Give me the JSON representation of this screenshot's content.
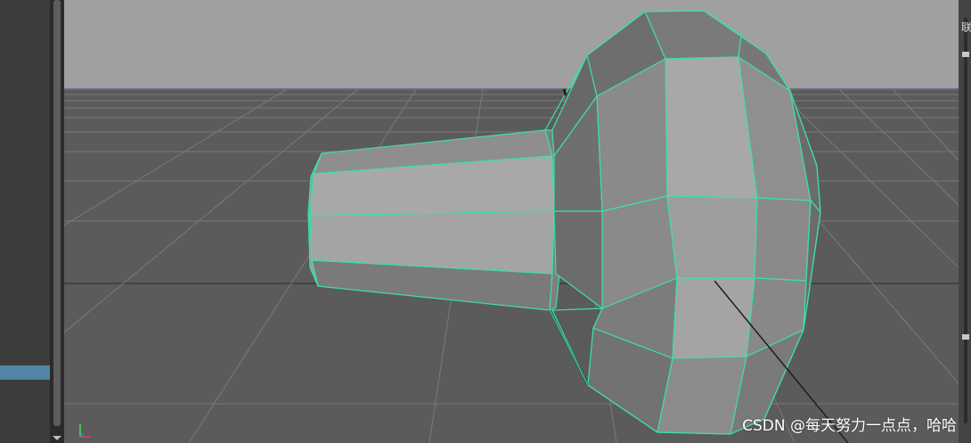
{
  "app": {
    "name": "3D modeling viewport",
    "view": "perspective",
    "object": "polygon mesh (lathe-like knob)"
  },
  "watermark": {
    "text": "CSDN @每天努力一点点，哈哈"
  },
  "right_panel": {
    "label": "联"
  },
  "colors": {
    "background": "#3c3c3c",
    "viewport_sky": "#a0a0a0",
    "viewport_ground": "#5b5b5b",
    "grid": "#7a7a7a",
    "mesh_edge": "#3ee0a4",
    "left_highlight": "#5285a6"
  },
  "icons": {
    "scroll_down": "chevron-down-icon",
    "axis": "axis-gizmo-icon"
  }
}
